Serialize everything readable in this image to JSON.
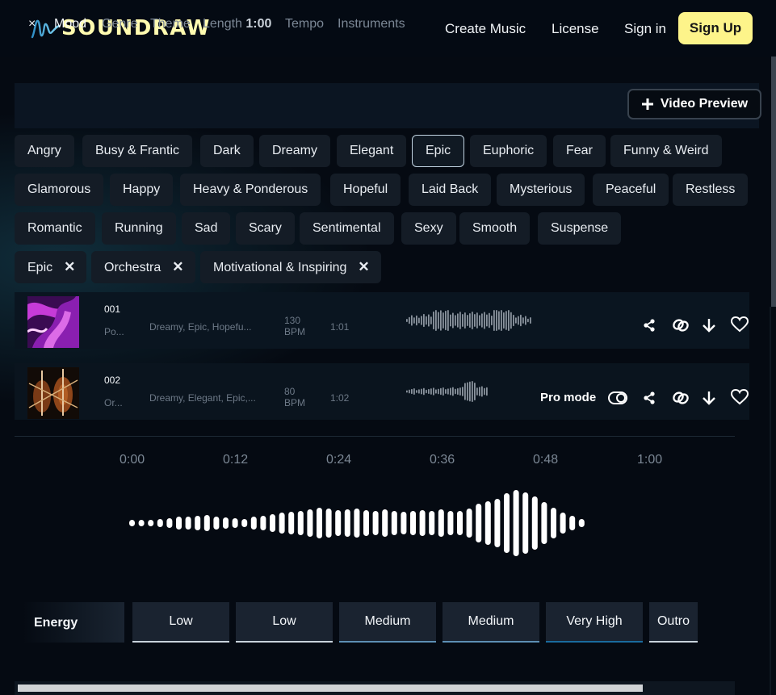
{
  "brand": {
    "logo_text": "SOUNDRAW",
    "logo_color": "#fffbb0"
  },
  "nav": {
    "create_music": "Create Music",
    "license": "License",
    "sign_in": "Sign in",
    "sign_up": "Sign Up"
  },
  "filters": {
    "close": "×",
    "tabs": [
      "Mood",
      "Genre",
      "Theme",
      "Length",
      "Tempo",
      "Instruments"
    ],
    "length_value": "1:00",
    "video_preview": "Video Preview"
  },
  "moods": [
    "Angry",
    "Busy & Frantic",
    "Dark",
    "Dreamy",
    "Elegant",
    "Epic",
    "Euphoric",
    "Fear",
    "Funny & Weird",
    "Glamorous",
    "Happy",
    "Heavy & Ponderous",
    "Hopeful",
    "Laid Back",
    "Mysterious",
    "Peaceful",
    "Restless",
    "Romantic",
    "Running",
    "Sad",
    "Scary",
    "Sentimental",
    "Sexy",
    "Smooth",
    "Suspense"
  ],
  "selected_mood": "Epic",
  "active_filters": [
    "Epic",
    "Orchestra",
    "Motivational & Inspiring"
  ],
  "tracks": [
    {
      "num": "001",
      "sub": "Po...",
      "tags": "Dreamy, Epic, Hopefu...",
      "bpm": "130",
      "bpm_unit": "BPM",
      "length": "1:01"
    },
    {
      "num": "002",
      "sub": "Or...",
      "tags": "Dreamy, Elegant, Epic,...",
      "bpm": "80",
      "bpm_unit": "BPM",
      "length": "1:02",
      "pro_mode": "Pro mode"
    }
  ],
  "timeline": [
    "0:00",
    "0:12",
    "0:24",
    "0:36",
    "0:48",
    "1:00"
  ],
  "energy": {
    "label": "Energy",
    "segments": [
      {
        "label": "Low",
        "color": "#c9d3dc"
      },
      {
        "label": "Low",
        "color": "#c9d3dc"
      },
      {
        "label": "Medium",
        "color": "#5d8fb4"
      },
      {
        "label": "Medium",
        "color": "#5d8fb4"
      },
      {
        "label": "Very High",
        "color": "#1a6b9e"
      },
      {
        "label": "Outro",
        "color": "#c9d3dc"
      }
    ]
  },
  "icons": [
    "share-icon",
    "link-icon",
    "download-icon",
    "heart-icon",
    "plus-icon",
    "toggle-icon",
    "close-icon"
  ]
}
